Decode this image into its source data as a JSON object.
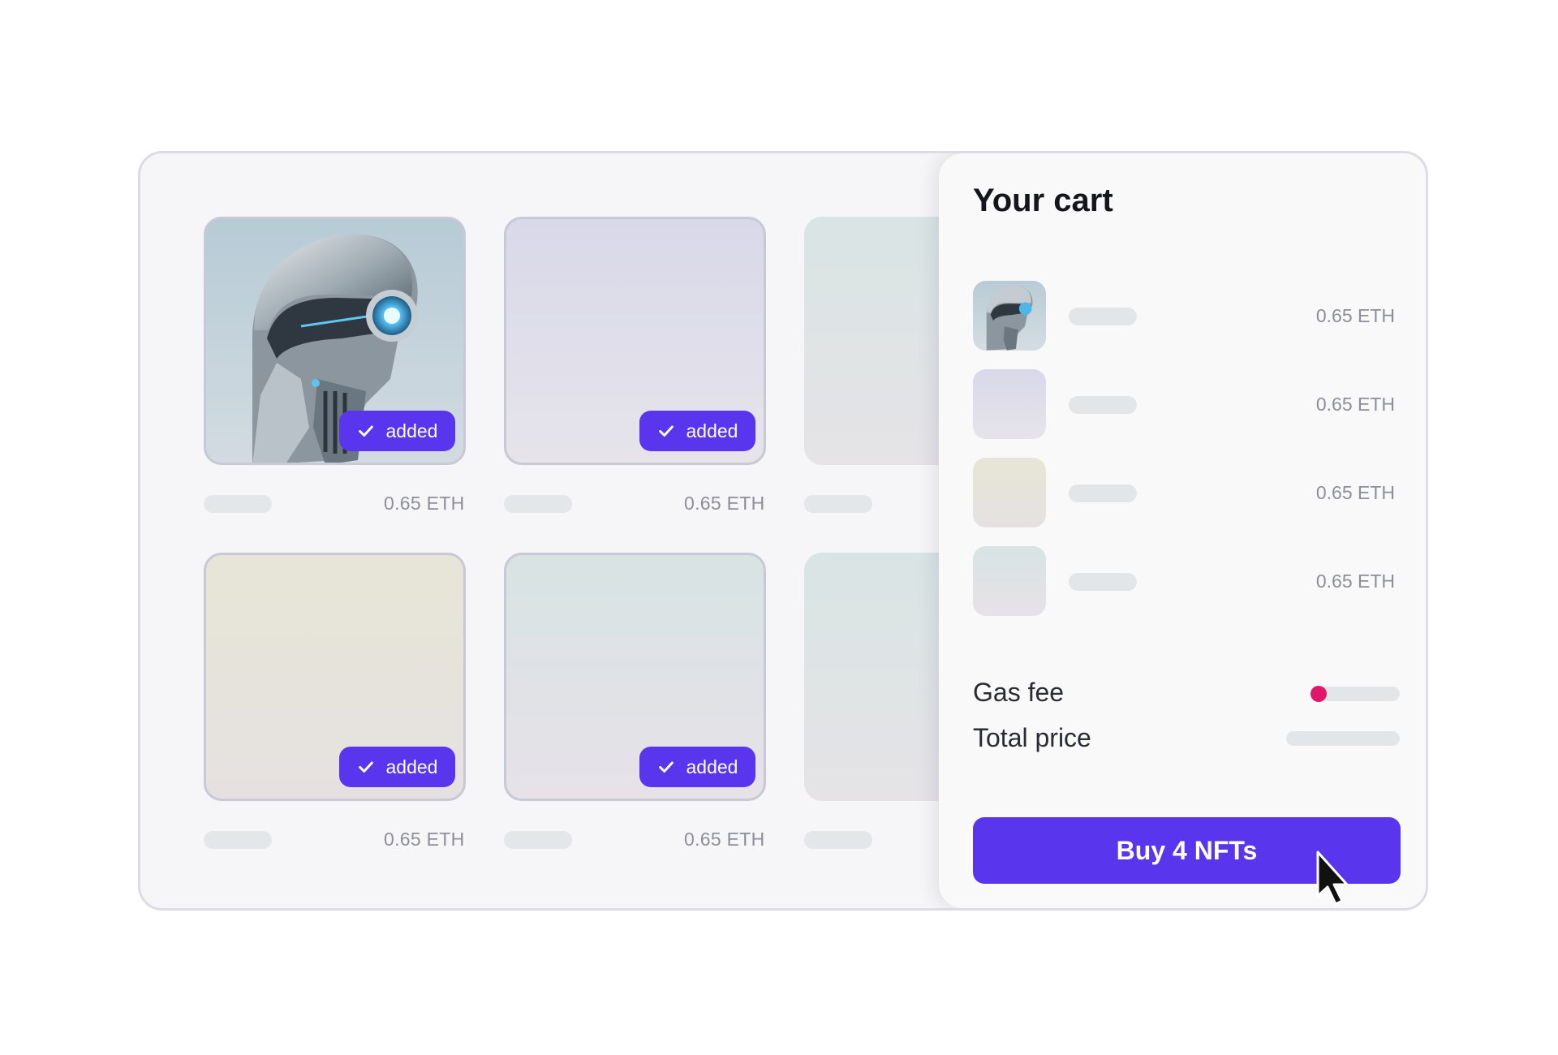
{
  "grid": {
    "cards": [
      {
        "badge": "added",
        "price": "0.65 ETH"
      },
      {
        "badge": "added",
        "price": "0.65 ETH"
      },
      {
        "badge": "added",
        "price": "0.65 ETH"
      },
      {
        "badge": "added",
        "price": "0.65 ETH"
      }
    ]
  },
  "cart": {
    "title": "Your cart",
    "items": [
      {
        "price": "0.65 ETH"
      },
      {
        "price": "0.65 ETH"
      },
      {
        "price": "0.65 ETH"
      },
      {
        "price": "0.65 ETH"
      }
    ],
    "gas_fee_label": "Gas fee",
    "total_price_label": "Total price",
    "buy_button_label": "Buy 4 NFTs"
  },
  "colors": {
    "accent": "#5a35ee",
    "gas_indicator": "#e0176b"
  },
  "icons": {
    "badge_icon": "check-icon",
    "cursor": "mouse-pointer-icon"
  }
}
